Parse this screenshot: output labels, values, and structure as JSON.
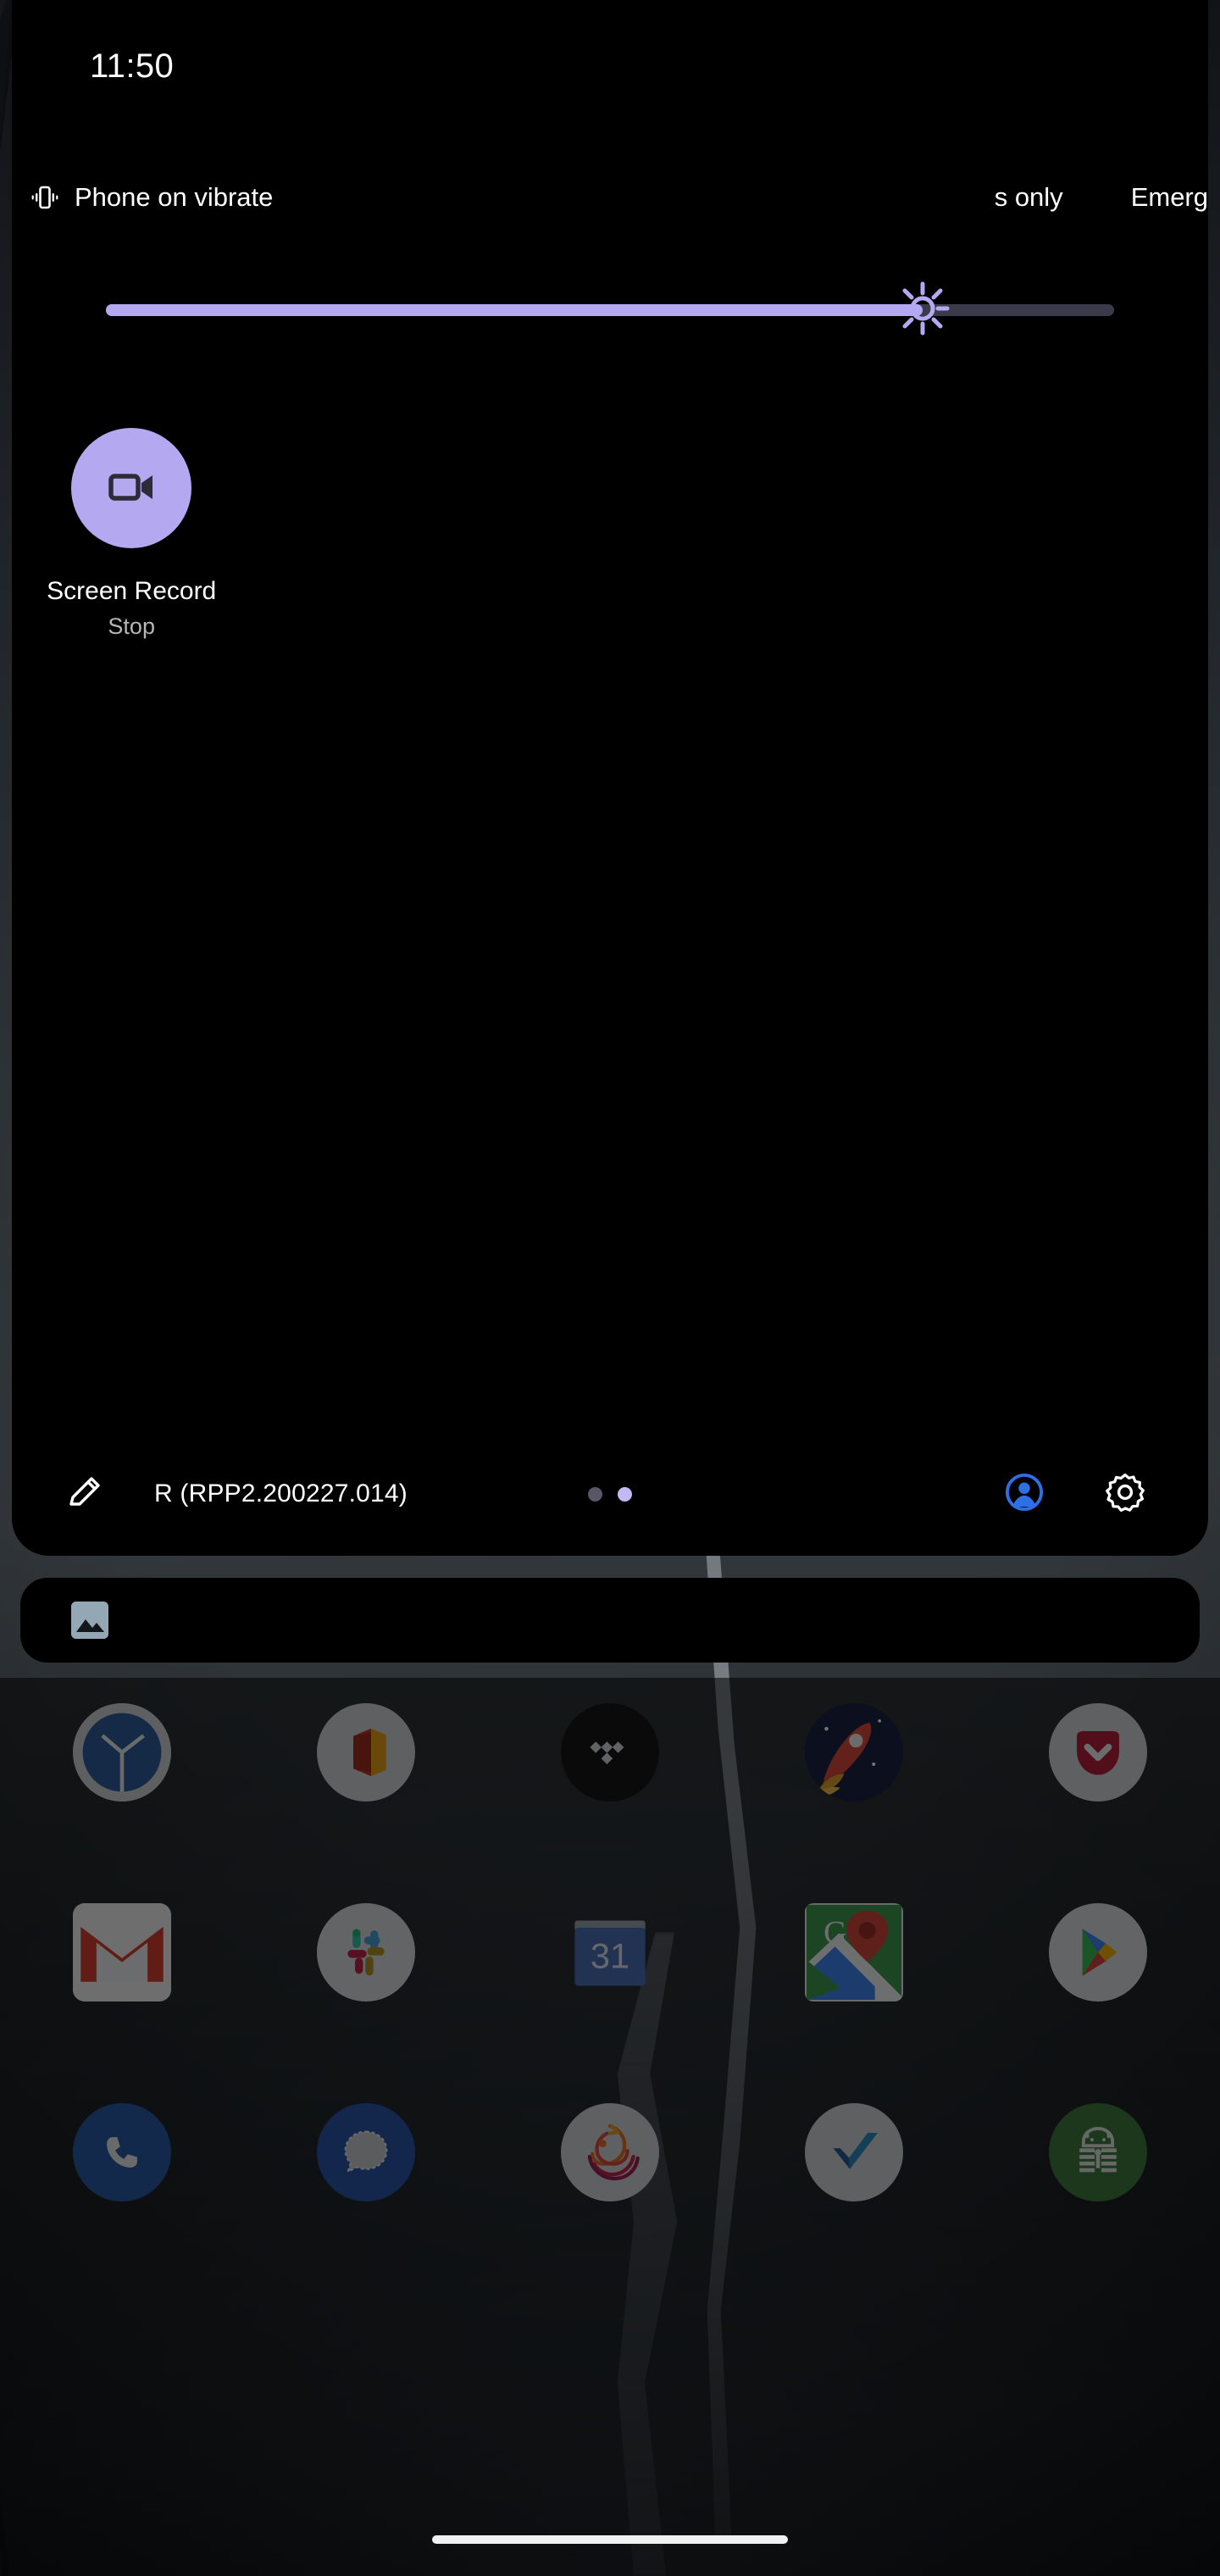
{
  "status_bar": {
    "clock": "11:50"
  },
  "qs_header": {
    "ringer_icon": "vibrate-icon",
    "ringer_text": "Phone on vibrate",
    "carrier_primary": "s only",
    "carrier_secondary": "Emerg"
  },
  "brightness": {
    "name": "brightness-slider",
    "icon": "brightness-sun-icon",
    "value_percent": 81,
    "fill_color": "#b4a9f0",
    "track_color": "#3a3a4a"
  },
  "tiles": [
    {
      "name": "screen-record",
      "icon": "video-camera-icon",
      "label": "Screen Record",
      "sub": "Stop",
      "active": true,
      "bg": "#b4a9f0",
      "fg": "#2e2b38"
    }
  ],
  "footer": {
    "edit_icon": "pencil-edit-icon",
    "build": "R (RPP2.200227.014)",
    "pages": {
      "count": 2,
      "active_index": 1
    },
    "user_icon": "user-avatar-icon",
    "user_icon_color": "#2f6fe4",
    "settings_icon": "gear-settings-icon"
  },
  "notification": {
    "name": "collapsed-notification",
    "icon": "photo-image-icon"
  },
  "home": {
    "apps": [
      {
        "name": "clock",
        "label": "Clock"
      },
      {
        "name": "office",
        "label": "Office"
      },
      {
        "name": "tidal",
        "label": "Tidal"
      },
      {
        "name": "rocket",
        "label": "Rocket"
      },
      {
        "name": "pocket",
        "label": "Pocket"
      },
      {
        "name": "gmail",
        "label": "Gmail"
      },
      {
        "name": "slack",
        "label": "Slack"
      },
      {
        "name": "calendar",
        "label": "Calendar",
        "badge": "31"
      },
      {
        "name": "maps",
        "label": "Maps"
      },
      {
        "name": "play-store",
        "label": "Play Store"
      },
      {
        "name": "phone",
        "label": "Phone"
      },
      {
        "name": "signal",
        "label": "Signal"
      },
      {
        "name": "firefox",
        "label": "Firefox"
      },
      {
        "name": "wunderlist",
        "label": "Wunderlist"
      },
      {
        "name": "keepass",
        "label": "KeePass"
      }
    ]
  },
  "navigation": {
    "gesture_pill": "home-gesture-pill"
  }
}
